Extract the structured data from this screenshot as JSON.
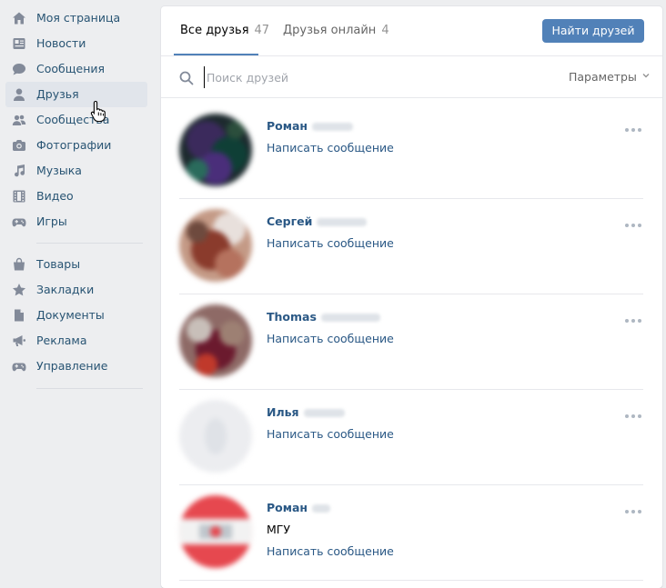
{
  "sidebar": {
    "groups": [
      [
        {
          "label": "Моя страница",
          "icon": "home-icon"
        },
        {
          "label": "Новости",
          "icon": "news-icon"
        },
        {
          "label": "Сообщения",
          "icon": "message-icon"
        },
        {
          "label": "Друзья",
          "icon": "user-icon",
          "active": true
        },
        {
          "label": "Сообщества",
          "icon": "community-icon"
        },
        {
          "label": "Фотографии",
          "icon": "camera-icon"
        },
        {
          "label": "Музыка",
          "icon": "music-icon"
        },
        {
          "label": "Видео",
          "icon": "video-icon"
        },
        {
          "label": "Игры",
          "icon": "gamepad-icon"
        }
      ],
      [
        {
          "label": "Товары",
          "icon": "bag-icon"
        },
        {
          "label": "Закладки",
          "icon": "star-icon"
        },
        {
          "label": "Документы",
          "icon": "document-icon"
        },
        {
          "label": "Реклама",
          "icon": "megaphone-icon"
        },
        {
          "label": "Управление",
          "icon": "gamepad-icon"
        }
      ]
    ]
  },
  "tabs": [
    {
      "label": "Все друзья",
      "count": "47",
      "active": true
    },
    {
      "label": "Друзья онлайн",
      "count": "4",
      "active": false
    }
  ],
  "find_button": "Найти друзей",
  "search": {
    "placeholder": "Поиск друзей"
  },
  "params_label": "Параметры",
  "friends": [
    {
      "name": "Роман",
      "message": "Написать сообщение",
      "avatar": "photo-dark"
    },
    {
      "name": "Сергей",
      "message": "Написать сообщение",
      "avatar": "photo-warm"
    },
    {
      "name": "Thomas",
      "message": "Написать сообщение",
      "avatar": "photo-red"
    },
    {
      "name": "Илья",
      "message": "Написать сообщение",
      "avatar": "placeholder"
    },
    {
      "name": "Роман",
      "subtitle": "МГУ",
      "message": "Написать сообщение",
      "avatar": "photo-badge"
    }
  ],
  "colors": {
    "accent": "#5181b8",
    "link": "#2a5885",
    "icon": "#828a99"
  }
}
